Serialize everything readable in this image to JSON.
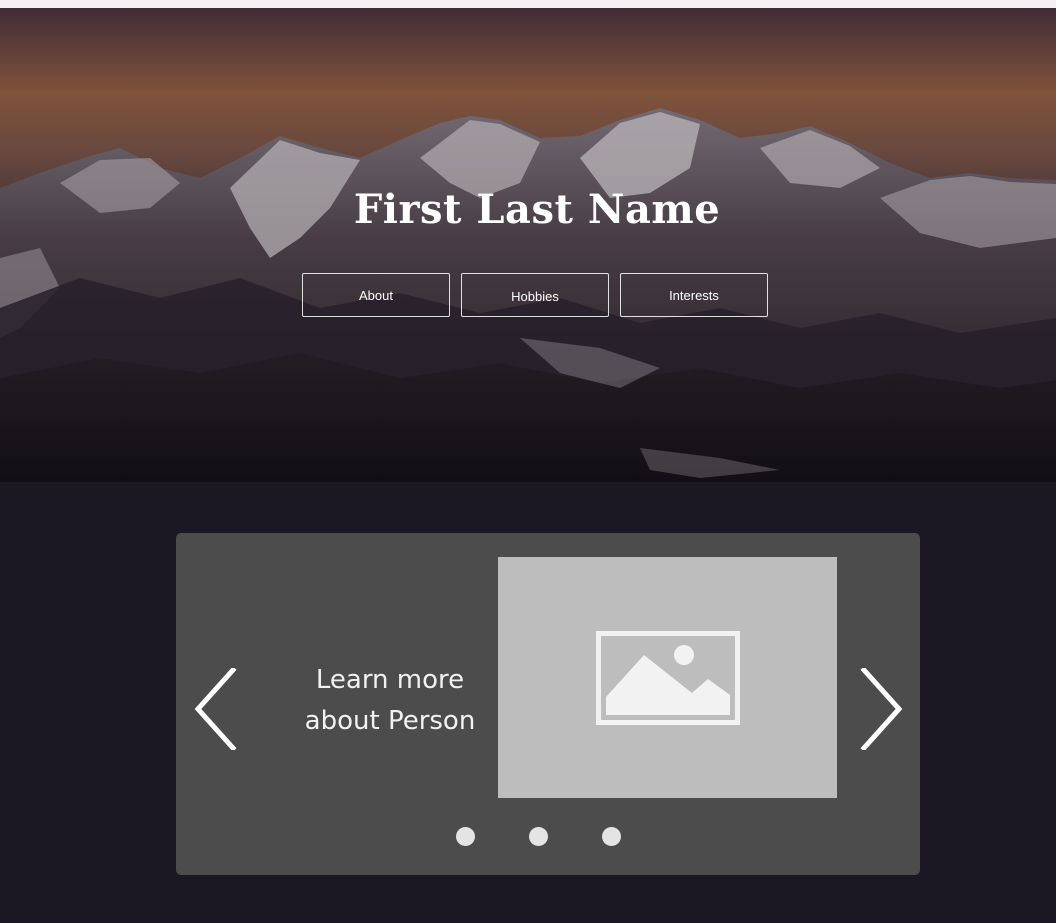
{
  "hero": {
    "title": "First Last Name",
    "nav": [
      {
        "label": "About"
      },
      {
        "label": "Hobbies"
      },
      {
        "label": "Interests"
      }
    ]
  },
  "carousel": {
    "text_line1": "Learn more",
    "text_line2": "about Person",
    "image_icon": "image-placeholder-icon",
    "prev_icon": "chevron-left-icon",
    "next_icon": "chevron-right-icon",
    "slide_count": 3
  },
  "colors": {
    "page_background": "#1b1823",
    "carousel_background": "#4c4c4c",
    "image_placeholder": "#bdbdbd",
    "dot": "#e4e4e4"
  }
}
